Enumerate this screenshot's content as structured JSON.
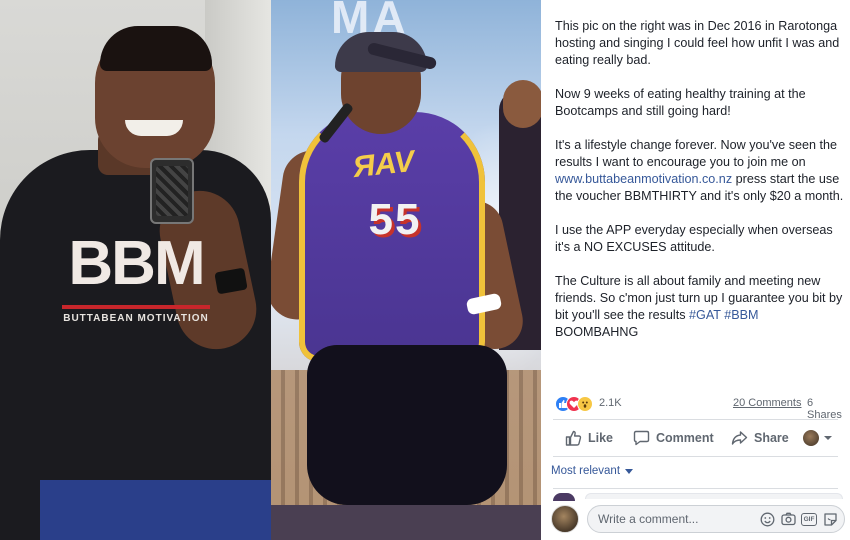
{
  "post": {
    "paragraphs": [
      "This pic on the right was in Dec 2016 in Rarotonga hosting and singing I could feel how unfit I was and eating really bad.",
      "Now 9 weeks of eating healthy training at the Bootcamps and still going hard!",
      "It's a lifestyle change forever. Now you've seen the results I want to encourage you to join me on ",
      "I use the APP everyday especially when overseas it's a NO EXCUSES attitude.",
      "The Culture is all about family and meeting new friends. So c'mon just turn up I guarantee you bit by bit you'll see the results "
    ],
    "link": "www.buttabeanmotivation.co.nz",
    "p3_tail": " press start the use the voucher BBMTHIRTY and it's only $20 a month.",
    "hashtag_gat": "#GAT",
    "hashtag_bbm": "#BBM",
    "p5_tail": "BOOMBAHNG"
  },
  "photo": {
    "left_shirt_logo": "BBM",
    "left_shirt_text": "BUTTABEAN MOTIVATION",
    "right_jersey_name": "ЯAV",
    "right_jersey_number": "55",
    "right_banner": "MA"
  },
  "reactions": {
    "count": "2.1K",
    "types": [
      "like-icon",
      "love-icon",
      "wow-icon"
    ],
    "comments": "20 Comments",
    "shares": "6 Shares"
  },
  "actions": {
    "like": "Like",
    "comment": "Comment",
    "share": "Share"
  },
  "comments": {
    "sort_label": "Most relevant",
    "input_placeholder": "Write a comment..."
  },
  "colors": {
    "link": "#365899",
    "text": "#1d2129",
    "muted": "#606770",
    "divider": "#dadde1",
    "like_blue": "#2e80f5",
    "love_red": "#f0334f",
    "wow_yellow": "#f7c744"
  }
}
